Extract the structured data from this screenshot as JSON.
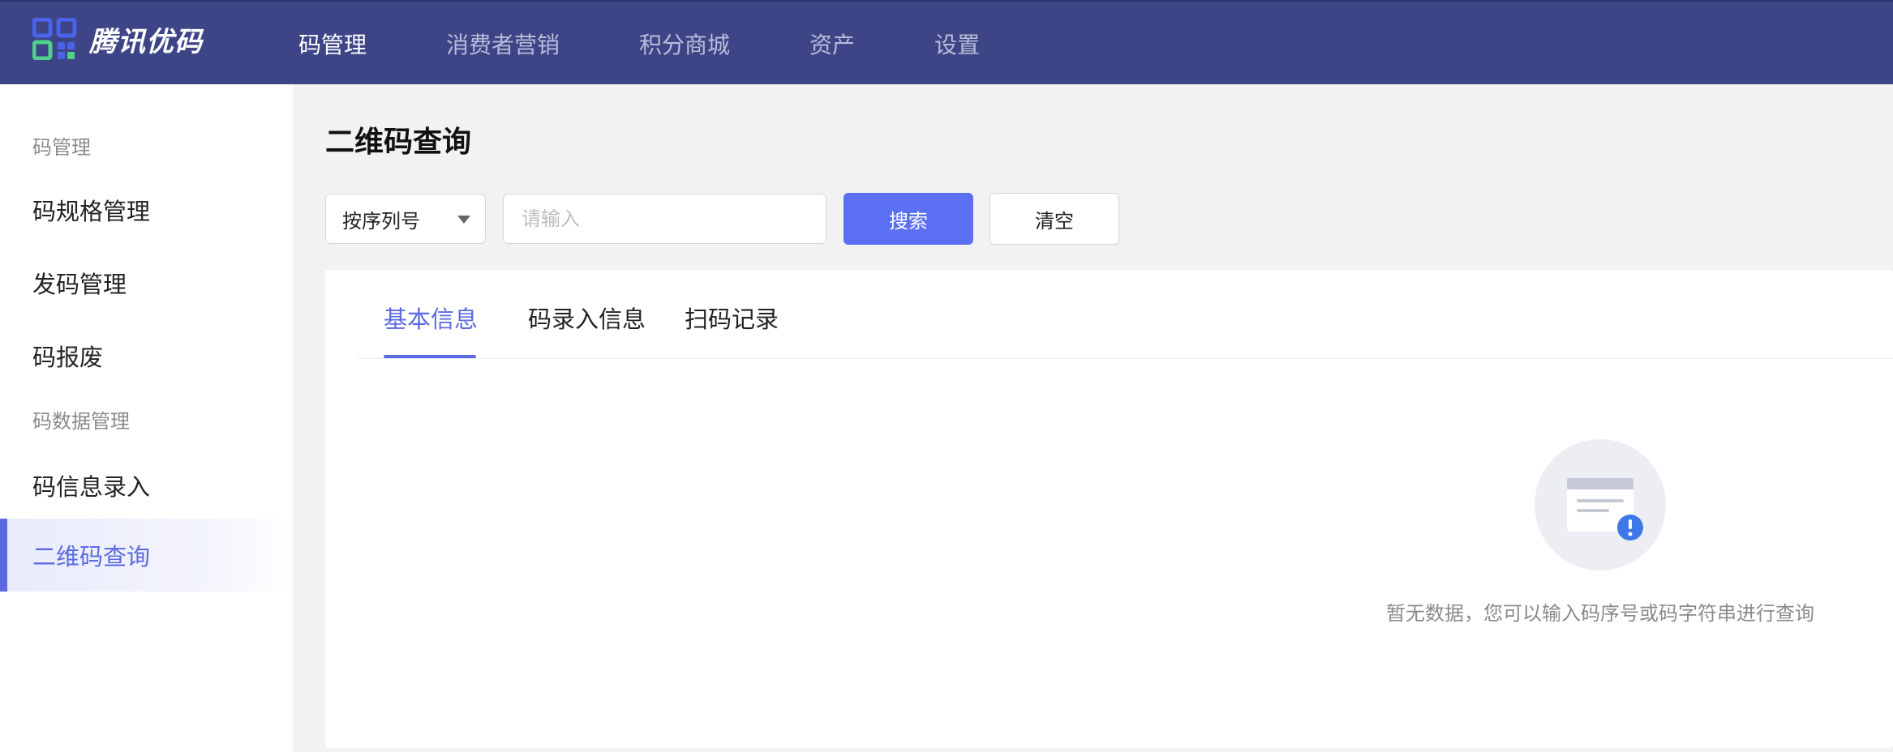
{
  "header": {
    "logo_text": "腾讯优码",
    "nav": [
      {
        "label": "码管理",
        "active": true
      },
      {
        "label": "消费者营销",
        "active": false
      },
      {
        "label": "积分商城",
        "active": false
      },
      {
        "label": "资产",
        "active": false
      },
      {
        "label": "设置",
        "active": false
      }
    ]
  },
  "sidebar": {
    "groups": [
      {
        "title": "码管理",
        "items": [
          "码规格管理",
          "发码管理",
          "码报废"
        ]
      },
      {
        "title": "码数据管理",
        "items": [
          "码信息录入",
          "二维码查询"
        ]
      }
    ],
    "active_item": "二维码查询"
  },
  "main": {
    "title": "二维码查询",
    "filter": {
      "select_value": "按序列号",
      "input_value": "",
      "input_placeholder": "请输入",
      "search_label": "搜索",
      "clear_label": "清空"
    },
    "tabs": [
      {
        "label": "基本信息",
        "active": true
      },
      {
        "label": "码录入信息",
        "active": false
      },
      {
        "label": "扫码记录",
        "active": false
      }
    ],
    "empty_state": {
      "icon": "empty-document-alert-icon",
      "text": "暂无数据，您可以输入码序号或码字符串进行查询"
    }
  },
  "colors": {
    "header_bg": "#3d4587",
    "accent": "#5b6ae0",
    "primary_button": "#5b6ff2",
    "page_bg": "#f2f2f2",
    "logo_blue": "#4b63e8",
    "logo_green": "#4fd18b"
  }
}
